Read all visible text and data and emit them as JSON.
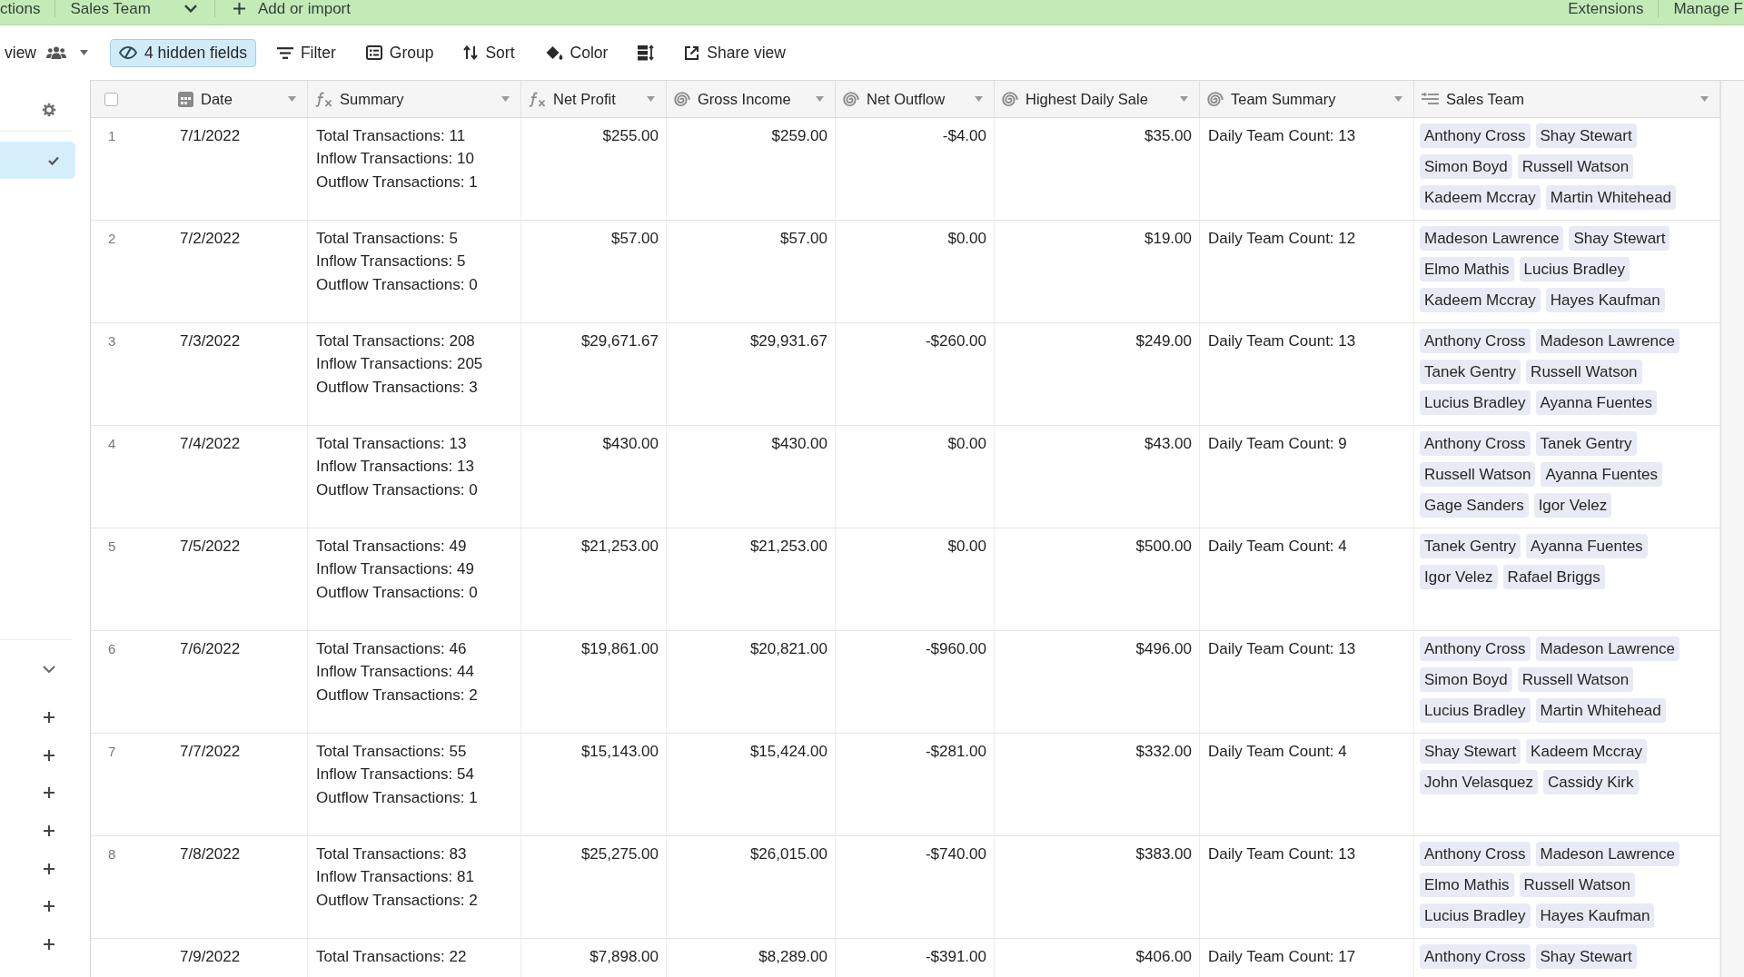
{
  "top_bar": {
    "tables": [
      {
        "label": "ctions",
        "selected": false
      },
      {
        "label": "Sales Team",
        "selected": true
      }
    ],
    "add_button": "Add or import",
    "right_items": [
      "Extensions",
      "Manage F"
    ]
  },
  "view_bar": {
    "view_name": "view",
    "tools": [
      {
        "kind": "hide_fields",
        "label": "4 hidden fields",
        "active": true
      },
      {
        "kind": "filter",
        "label": "Filter",
        "active": false
      },
      {
        "kind": "group",
        "label": "Group",
        "active": false
      },
      {
        "kind": "sort",
        "label": "Sort",
        "active": false
      },
      {
        "kind": "color",
        "label": "Color",
        "active": false
      },
      {
        "kind": "row_height",
        "active": false
      },
      {
        "kind": "share",
        "label": "Share view",
        "active": false
      }
    ]
  },
  "sidebar": {
    "views": [
      {
        "selected": true
      }
    ]
  },
  "table": {
    "select_all": {
      "checked": false
    },
    "columns": [
      {
        "kind": "date",
        "label": "Date",
        "numeric": false
      },
      {
        "kind": "formula",
        "label": "Summary",
        "numeric": false
      },
      {
        "kind": "formula",
        "label": "Net Profit",
        "numeric": true
      },
      {
        "kind": "rollup",
        "label": "Gross Income",
        "numeric": true
      },
      {
        "kind": "rollup",
        "label": "Net Outflow",
        "numeric": true
      },
      {
        "kind": "rollup",
        "label": "Highest Daily Sale",
        "numeric": true
      },
      {
        "kind": "rollup",
        "label": "Team Summary",
        "numeric": false
      },
      {
        "kind": "link",
        "label": "Sales Team",
        "numeric": false
      }
    ],
    "rows": [
      {
        "number": "1",
        "date": "7/1/2022",
        "summary": [
          "Total Transactions: 11",
          "Inflow Transactions: 10",
          "Outflow Transactions: 1"
        ],
        "net_profit": "$255.00",
        "gross_income": "$259.00",
        "net_outflow": "-$4.00",
        "highest_daily_sale": "$35.00",
        "team_summary": "Daily Team Count: 13",
        "sales_team": [
          "Anthony Cross",
          "Shay Stewart",
          "Simon Boyd",
          "Russell Watson",
          "Kadeem Mccray",
          "Martin Whitehead"
        ]
      },
      {
        "number": "2",
        "date": "7/2/2022",
        "summary": [
          "Total Transactions: 5",
          "Inflow Transactions: 5",
          "Outflow Transactions: 0"
        ],
        "net_profit": "$57.00",
        "gross_income": "$57.00",
        "net_outflow": "$0.00",
        "highest_daily_sale": "$19.00",
        "team_summary": "Daily Team Count: 12",
        "sales_team": [
          "Madeson Lawrence",
          "Shay Stewart",
          "Elmo Mathis",
          "Lucius Bradley",
          "Kadeem Mccray",
          "Hayes Kaufman"
        ]
      },
      {
        "number": "3",
        "date": "7/3/2022",
        "summary": [
          "Total Transactions: 208",
          "Inflow Transactions: 205",
          "Outflow Transactions: 3"
        ],
        "net_profit": "$29,671.67",
        "gross_income": "$29,931.67",
        "net_outflow": "-$260.00",
        "highest_daily_sale": "$249.00",
        "team_summary": "Daily Team Count: 13",
        "sales_team": [
          "Anthony Cross",
          "Madeson Lawrence",
          "Tanek Gentry",
          "Russell Watson",
          "Lucius Bradley",
          "Ayanna Fuentes"
        ]
      },
      {
        "number": "4",
        "date": "7/4/2022",
        "summary": [
          "Total Transactions: 13",
          "Inflow Transactions: 13",
          "Outflow Transactions: 0"
        ],
        "net_profit": "$430.00",
        "gross_income": "$430.00",
        "net_outflow": "$0.00",
        "highest_daily_sale": "$43.00",
        "team_summary": "Daily Team Count: 9",
        "sales_team": [
          "Anthony Cross",
          "Tanek Gentry",
          "Russell Watson",
          "Ayanna Fuentes",
          "Gage Sanders",
          "Igor Velez"
        ]
      },
      {
        "number": "5",
        "date": "7/5/2022",
        "summary": [
          "Total Transactions: 49",
          "Inflow Transactions: 49",
          "Outflow Transactions: 0"
        ],
        "net_profit": "$21,253.00",
        "gross_income": "$21,253.00",
        "net_outflow": "$0.00",
        "highest_daily_sale": "$500.00",
        "team_summary": "Daily Team Count: 4",
        "sales_team": [
          "Tanek Gentry",
          "Ayanna Fuentes",
          "Igor Velez",
          "Rafael Briggs"
        ]
      },
      {
        "number": "6",
        "date": "7/6/2022",
        "summary": [
          "Total Transactions: 46",
          "Inflow Transactions: 44",
          "Outflow Transactions: 2"
        ],
        "net_profit": "$19,861.00",
        "gross_income": "$20,821.00",
        "net_outflow": "-$960.00",
        "highest_daily_sale": "$496.00",
        "team_summary": "Daily Team Count: 13",
        "sales_team": [
          "Anthony Cross",
          "Madeson Lawrence",
          "Simon Boyd",
          "Russell Watson",
          "Lucius Bradley",
          "Martin Whitehead"
        ]
      },
      {
        "number": "7",
        "date": "7/7/2022",
        "summary": [
          "Total Transactions: 55",
          "Inflow Transactions: 54",
          "Outflow Transactions: 1"
        ],
        "net_profit": "$15,143.00",
        "gross_income": "$15,424.00",
        "net_outflow": "-$281.00",
        "highest_daily_sale": "$332.00",
        "team_summary": "Daily Team Count: 4",
        "sales_team": [
          "Shay Stewart",
          "Kadeem Mccray",
          "John Velasquez",
          "Cassidy Kirk"
        ]
      },
      {
        "number": "8",
        "date": "7/8/2022",
        "summary": [
          "Total Transactions: 83",
          "Inflow Transactions: 81",
          "Outflow Transactions: 2"
        ],
        "net_profit": "$25,275.00",
        "gross_income": "$26,015.00",
        "net_outflow": "-$740.00",
        "highest_daily_sale": "$383.00",
        "team_summary": "Daily Team Count: 13",
        "sales_team": [
          "Anthony Cross",
          "Madeson Lawrence",
          "Elmo Mathis",
          "Russell Watson",
          "Lucius Bradley",
          "Hayes Kaufman"
        ]
      },
      {
        "date": "7/9/2022",
        "summary": [
          "Total Transactions: 22"
        ],
        "net_profit": "$7,898.00",
        "gross_income": "$8,289.00",
        "net_outflow": "-$391.00",
        "highest_daily_sale": "$406.00",
        "team_summary": "Daily Team Count: 17",
        "sales_team": [
          "Anthony Cross",
          "Shay Stewart"
        ]
      }
    ]
  }
}
